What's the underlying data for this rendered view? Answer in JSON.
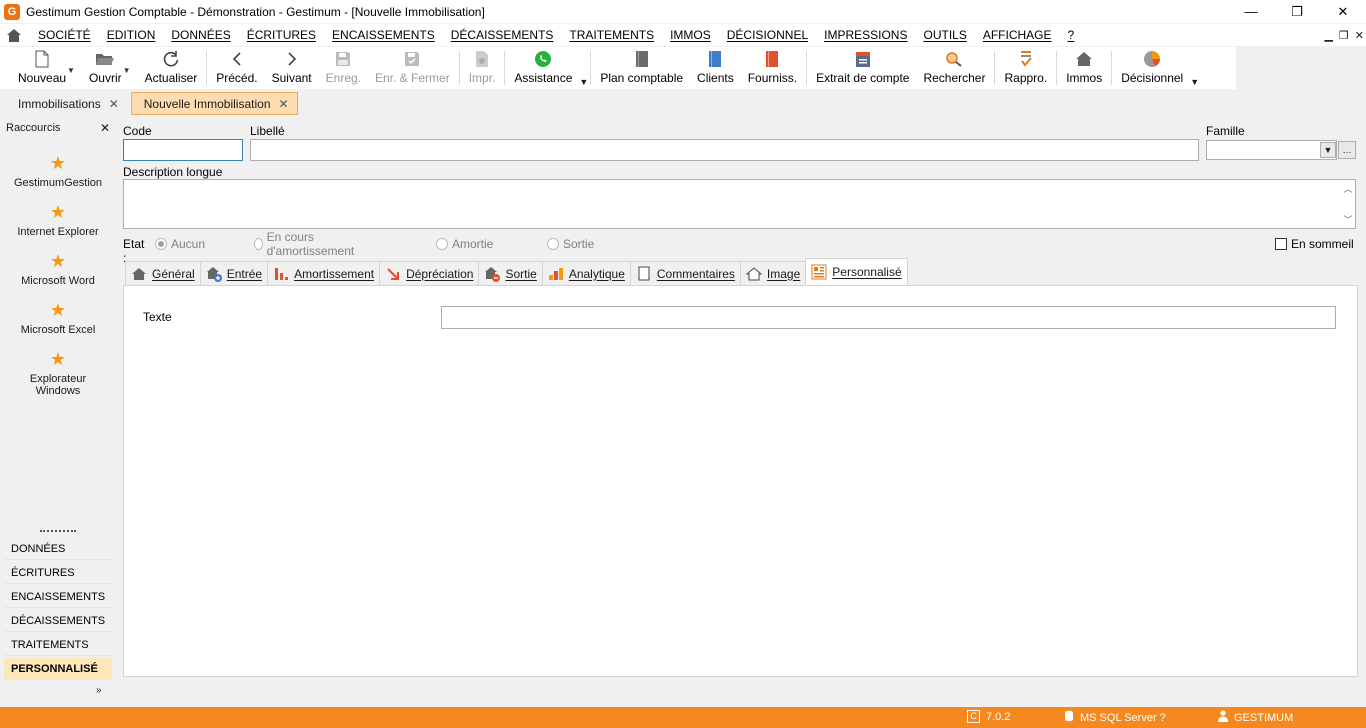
{
  "window": {
    "title": "Gestimum Gestion Comptable - Démonstration - Gestimum - [Nouvelle Immobilisation]",
    "logo_letter": "G",
    "minimize": "—",
    "restore": "❐",
    "close": "✕"
  },
  "menu": {
    "items": [
      "SOCIÉTÉ",
      "EDITION",
      "DONNÉES",
      "ÉCRITURES",
      "ENCAISSEMENTS",
      "DÉCAISSEMENTS",
      "TRAITEMENTS",
      "IMMOS",
      "DÉCISIONNEL",
      "IMPRESSIONS",
      "OUTILS",
      "AFFICHAGE",
      "?"
    ],
    "mdi_min": "▁",
    "mdi_restore": "❐",
    "mdi_close": "✕"
  },
  "toolbar": {
    "nouveau": "Nouveau",
    "ouvrir": "Ouvrir",
    "actualiser": "Actualiser",
    "preced": "Précéd.",
    "suivant": "Suivant",
    "enreg": "Enreg.",
    "enr_fermer": "Enr. & Fermer",
    "impr": "Impr.",
    "assistance": "Assistance",
    "plan_comptable": "Plan comptable",
    "clients": "Clients",
    "fourniss": "Fourniss.",
    "extrait": "Extrait de compte",
    "rechercher": "Rechercher",
    "rappro": "Rappro.",
    "immos": "Immos",
    "decisionnel": "Décisionnel"
  },
  "doc_tabs": [
    {
      "label": "Immobilisations",
      "active": false
    },
    {
      "label": "Nouvelle Immobilisation",
      "active": true
    }
  ],
  "sidebar": {
    "title": "Raccourcis",
    "shortcuts": [
      "GestimumGestion",
      "Internet Explorer",
      "Microsoft Word",
      "Microsoft Excel",
      "Explorateur Windows"
    ],
    "sections": [
      "DONNÉES",
      "ÉCRITURES",
      "ENCAISSEMENTS",
      "DÉCAISSEMENTS",
      "TRAITEMENTS",
      "PERSONNALISÉ"
    ],
    "active_section": "PERSONNALISÉ"
  },
  "form": {
    "code_label": "Code",
    "code_value": "",
    "libelle_label": "Libellé",
    "libelle_value": "",
    "famille_label": "Famille",
    "famille_value": "",
    "description_label": "Description longue",
    "description_value": "",
    "etat_label": "Etat :",
    "etat_options": [
      "Aucun",
      "En cours d'amortissement",
      "Amortie",
      "Sortie"
    ],
    "etat_selected": "Aucun",
    "sommeil_label": "En sommeil",
    "sommeil_checked": false
  },
  "tabs": [
    "Général",
    "Entrée",
    "Amortissement",
    "Dépréciation",
    "Sortie",
    "Analytique",
    "Commentaires",
    "Image",
    "Personnalisé"
  ],
  "active_tab": "Personnalisé",
  "panel": {
    "texte_label": "Texte",
    "texte_value": ""
  },
  "status": {
    "version": "7.0.2",
    "server": "MS SQL Server ?",
    "user": "GESTIMUM"
  },
  "colors": {
    "accent": "#f5891f",
    "active_tab_bg": "#fddcb1",
    "active_section_bg": "#fde7b9",
    "star": "#f39a12"
  }
}
